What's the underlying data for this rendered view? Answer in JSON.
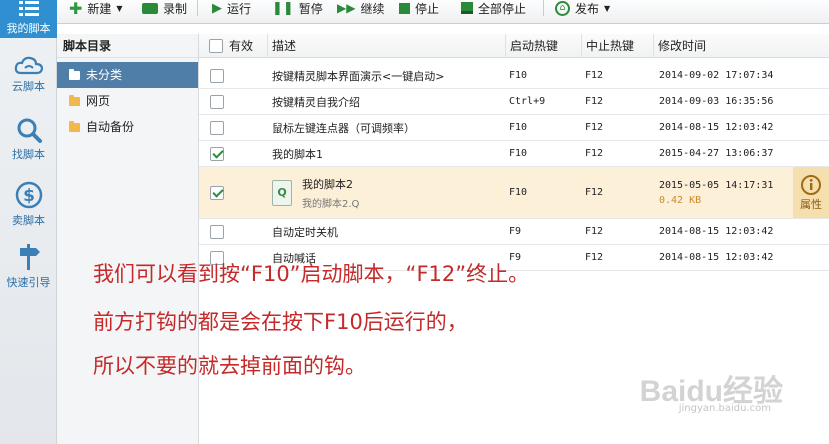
{
  "nav": {
    "items": [
      {
        "label": "我的脚本",
        "icon": "list-icon",
        "active": true
      },
      {
        "label": "云脚本",
        "icon": "cloud-icon"
      },
      {
        "label": "找脚本",
        "icon": "search-icon"
      },
      {
        "label": "卖脚本",
        "icon": "dollar-icon"
      },
      {
        "label": "快速引导",
        "icon": "signpost-icon"
      }
    ]
  },
  "toolbar": {
    "new": "新建",
    "record": "录制",
    "run": "运行",
    "pause": "暂停",
    "resume": "继续",
    "stop": "停止",
    "stop_all": "全部停止",
    "publish": "发布"
  },
  "tree": {
    "title": "脚本目录",
    "items": [
      {
        "label": "未分类",
        "selected": true
      },
      {
        "label": "网页"
      },
      {
        "label": "自动备份"
      }
    ]
  },
  "table": {
    "headers": {
      "enabled": "有效",
      "desc": "描述",
      "start": "启动热键",
      "stop": "中止热键",
      "modified": "修改时间"
    },
    "rows": [
      {
        "checked": false,
        "desc": "按键精灵脚本界面演示<一键启动>",
        "start": "F10",
        "stop": "F12",
        "modified": "2014-09-02 17:07:34"
      },
      {
        "checked": false,
        "desc": "按键精灵自我介绍",
        "start": "Ctrl+9",
        "stop": "F12",
        "modified": "2014-09-03 16:35:56"
      },
      {
        "checked": false,
        "desc": "鼠标左键连点器（可调频率）",
        "start": "F10",
        "stop": "F12",
        "modified": "2014-08-15 12:03:42"
      },
      {
        "checked": true,
        "desc": "我的脚本1",
        "start": "F10",
        "stop": "F12",
        "modified": "2015-04-27 13:06:37"
      },
      {
        "checked": true,
        "desc": "我的脚本2",
        "file": "我的脚本2.Q",
        "size": "0.42 KB",
        "start": "F10",
        "stop": "F12",
        "modified": "2015-05-05 14:17:31",
        "highlight": true,
        "prop_label": "属性"
      },
      {
        "checked": false,
        "desc": "自动定时关机",
        "start": "F9",
        "stop": "F12",
        "modified": "2014-08-15 12:03:42"
      },
      {
        "checked": false,
        "desc": "自动喊话",
        "start": "F9",
        "stop": "F12",
        "modified": "2014-08-15 12:03:42"
      }
    ]
  },
  "annotation": {
    "line1": "我们可以看到按“F10”启动脚本，“F12”终止。",
    "line2": "前方打钩的都是会在按下F10后运行的，",
    "line3": "所以不要的就去掉前面的钩。"
  },
  "watermark": {
    "brand": "Baidu经验",
    "url": "jingyan.baidu.com"
  }
}
